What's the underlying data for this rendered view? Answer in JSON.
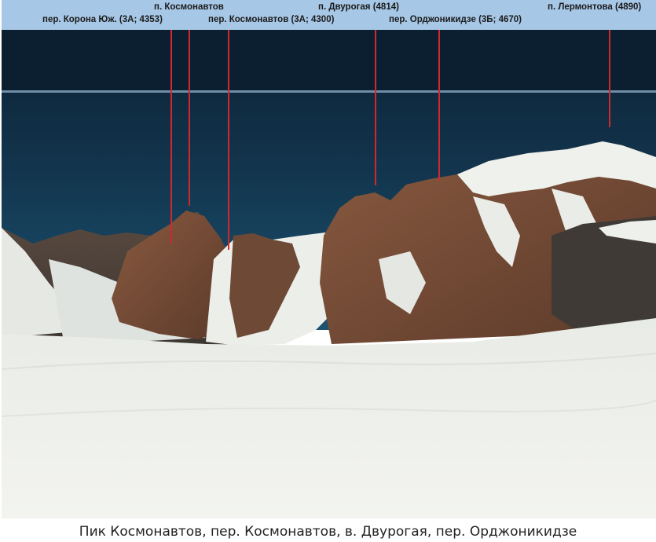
{
  "labels": {
    "cosmonauts_peak": "п. Космонавтов",
    "dvurogaya_peak": "п. Двурогая (4814)",
    "lermontov_peak": "п. Лермонтова (4890)",
    "korona_pass": "пер. Корона Юж. (3А; 4353)",
    "cosmonauts_pass": "пер. Космонавтов (3А; 4300)",
    "ordzhonikidze_pass": "пер. Орджоникидзе (3Б; 4670)"
  },
  "caption": "Пик Космонавтов, пер. Космонавтов, в. Двурогая, пер. Орджоникидзе",
  "colors": {
    "label_band": "#a7c7e6",
    "pointer_line": "#d0282e",
    "sky_top": "#0d2236",
    "sky_bottom": "#1a4e6e",
    "rock": "#7a4a33",
    "snow": "#eef0ea"
  }
}
